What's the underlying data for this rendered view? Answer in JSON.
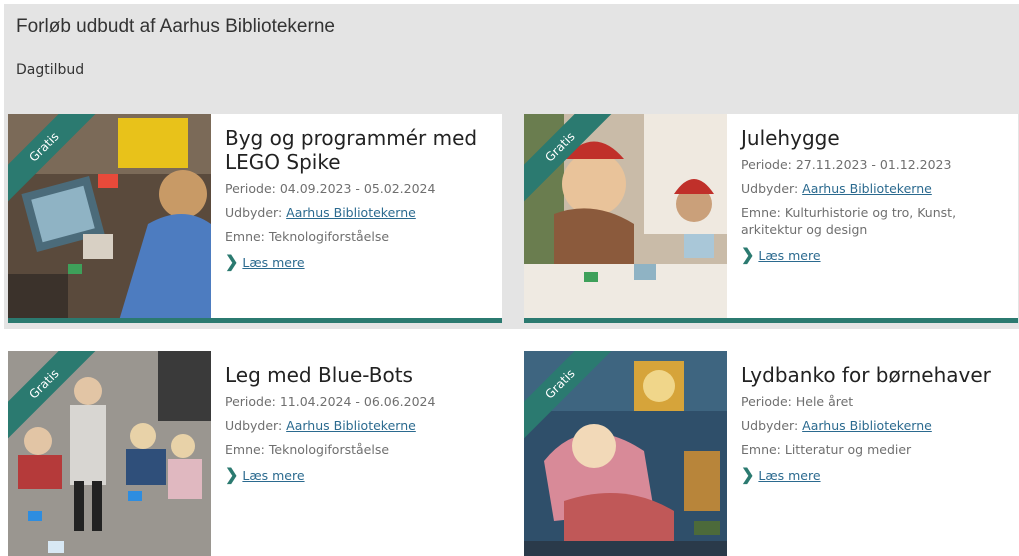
{
  "page": {
    "title": "Forløb udbudt af Aarhus Bibliotekerne",
    "subtitle": "Dagtilbud"
  },
  "colors": {
    "accent": "#2b7a70",
    "link": "#2b6a8f",
    "band": "#e4e4e4"
  },
  "cards": [
    {
      "badge": "Gratis",
      "title": "Byg og programmér med LEGO Spike",
      "period": "Periode: 04.09.2023 - 05.02.2024",
      "provider_label": "Udbyder:",
      "provider": "Aarhus Bibliotekerne",
      "subject": "Emne: Teknologiforståelse",
      "read_more": "Læs mere"
    },
    {
      "badge": "Gratis",
      "title": "Julehygge",
      "period": "Periode: 27.11.2023 - 01.12.2023",
      "provider_label": "Udbyder:",
      "provider": "Aarhus Bibliotekerne",
      "subject": "Emne: Kulturhistorie og tro, Kunst, arkitektur og design",
      "read_more": "Læs mere"
    },
    {
      "badge": "Gratis",
      "title": "Leg med Blue-Bots",
      "period": "Periode: 11.04.2024 - 06.06.2024",
      "provider_label": "Udbyder:",
      "provider": "Aarhus Bibliotekerne",
      "subject": "Emne: Teknologiforståelse",
      "read_more": "Læs mere"
    },
    {
      "badge": "Gratis",
      "title": "Lydbanko for børnehaver",
      "period": "Periode: Hele året",
      "provider_label": "Udbyder:",
      "provider": "Aarhus Bibliotekerne",
      "subject": "Emne: Litteratur og medier",
      "read_more": "Læs mere"
    }
  ],
  "icons": {
    "read_more": "chevron-right-icon"
  }
}
